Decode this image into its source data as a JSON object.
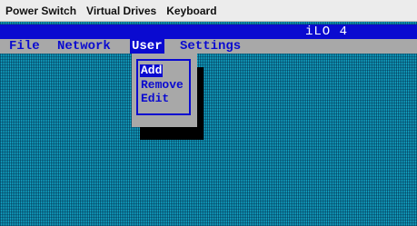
{
  "host_menu": {
    "items": [
      {
        "label": "Power Switch"
      },
      {
        "label": "Virtual Drives"
      },
      {
        "label": "Keyboard"
      }
    ]
  },
  "console": {
    "title": "iLO 4",
    "menu": [
      {
        "label": "File"
      },
      {
        "label": "Network"
      },
      {
        "label": "User"
      },
      {
        "label": "Settings"
      }
    ],
    "active_menu": "User",
    "dropdown": {
      "items": [
        {
          "label": "Add"
        },
        {
          "label": "Remove"
        },
        {
          "label": "Edit"
        }
      ],
      "selected": "Add"
    }
  },
  "colors": {
    "screen_background": "#12a0c0",
    "title_bar": "#0a0ad0",
    "menu_bar": "#a8a8a8",
    "menu_text": "#0a0ad0",
    "highlight_text": "#ffffff"
  }
}
